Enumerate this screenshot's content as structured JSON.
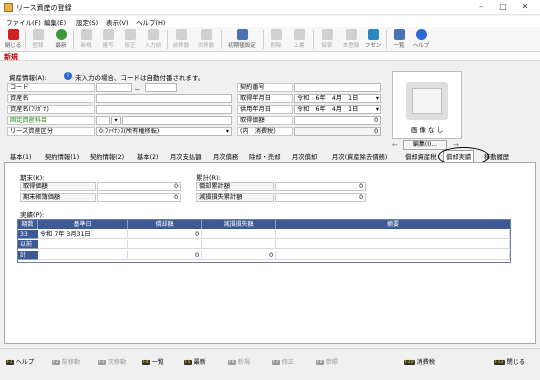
{
  "window": {
    "title": "リース資産の登録"
  },
  "menu": [
    "ファイル(F)",
    "編集(E)",
    "設定(S)",
    "表示(V)",
    "ヘルプ(H)"
  ],
  "toolbar": {
    "items": [
      {
        "label": "閉じる",
        "icon": "close-icon",
        "color": "#d32020"
      },
      {
        "label": "登録",
        "icon": "save-icon",
        "color": "#888888"
      },
      {
        "label": "最新",
        "icon": "refresh-icon",
        "color": "#3a9a3a"
      },
      {
        "label": "新規",
        "icon": "new-icon",
        "color": "#888888"
      },
      {
        "label": "複写",
        "icon": "copy-icon",
        "color": "#888888"
      },
      {
        "label": "修正",
        "icon": "edit-icon",
        "color": "#888888"
      },
      {
        "label": "入力前",
        "icon": "undo-icon",
        "color": "#888888"
      },
      {
        "label": "前移動",
        "icon": "up-icon",
        "color": "#888888"
      },
      {
        "label": "次移動",
        "icon": "down-icon",
        "color": "#888888"
      },
      {
        "label": "初期値設定",
        "icon": "grid-settings-icon",
        "color": "#4a70b8"
      },
      {
        "label": "削除",
        "icon": "delete-icon",
        "color": "#888888"
      },
      {
        "label": "上書",
        "icon": "overwrite-icon",
        "color": "#888888"
      },
      {
        "label": "探索",
        "icon": "search-icon",
        "color": "#888888"
      },
      {
        "label": "本登録",
        "icon": "register-icon",
        "color": "#888888"
      },
      {
        "label": "フセン",
        "icon": "sticky-note-icon",
        "color": "#2a8ac0"
      },
      {
        "label": "一覧",
        "icon": "list-icon",
        "color": "#4a70b8"
      },
      {
        "label": "ヘルプ",
        "icon": "help-icon",
        "color": "#2a6ad0"
      }
    ]
  },
  "mode": "新規",
  "asset_info": {
    "section_label": "資産情報(A):",
    "notice": "未入力の場合、コードは自動付番されます。",
    "code_label": "コード",
    "code_dash": "－",
    "name_label": "資産名",
    "kana_label": "資産名(ﾌﾘｶﾞﾅ)",
    "fixed_subject_label": "固定資産科目",
    "category_label": "リース資産区分",
    "category_value": "0:ﾌｧｲﾅﾝｽ(所有権移転)"
  },
  "contract": {
    "number_label": "契約番号",
    "acquire_label": "取得年月日",
    "acquire_value": "令和　6年　4月　1日",
    "use_label": "供用年月日",
    "use_value": "令和　6年　4月　1日",
    "price_label": "取得価額",
    "price_value": "0",
    "tax_label": "(内　消費税)",
    "tax_value": "0"
  },
  "photo": {
    "caption": "画 像 な し",
    "edit_button": "編集(I)..."
  },
  "tabs": [
    "基本(1)",
    "契約情報(1)",
    "契約情報(2)",
    "基本(2)",
    "月次支払額",
    "月次償務",
    "除却・売却",
    "月次償却",
    "月次(資産除去債務)",
    "償却資産税",
    "償却実績",
    "移動履歴"
  ],
  "active_tab": "償却実績",
  "summary": {
    "period_label": "期末(K):",
    "acq_label": "取得価額",
    "acq_value": "0",
    "book_label": "期末帳簿価額",
    "book_value": "0",
    "cumulative_label": "累計(R):",
    "dep_label": "償却累計額",
    "dep_value": "0",
    "imp_label": "減損損失累計額",
    "imp_value": "0"
  },
  "records": {
    "label": "実績(P):",
    "headers": [
      "期数",
      "基準日",
      "償却額",
      "減損損失額",
      "摘要"
    ],
    "rows": [
      {
        "period": "33",
        "date": "令和 7年 3月31日",
        "dep": "0",
        "imp": "",
        "memo": ""
      },
      {
        "period": "以前",
        "date": "",
        "dep": "",
        "imp": "",
        "memo": ""
      },
      {
        "period": "計",
        "date": "",
        "dep": "0",
        "imp": "0",
        "memo": ""
      }
    ]
  },
  "footer": [
    {
      "key": "F1",
      "label": "ヘルプ",
      "enabled": true
    },
    {
      "key": "F2",
      "label": "前移動",
      "enabled": false
    },
    {
      "key": "F3",
      "label": "次移動",
      "enabled": false
    },
    {
      "key": "F4",
      "label": "一覧",
      "enabled": true
    },
    {
      "key": "F5",
      "label": "最新",
      "enabled": true
    },
    {
      "key": "F6",
      "label": "新規",
      "enabled": false
    },
    {
      "key": "F7",
      "label": "修正",
      "enabled": false
    },
    {
      "key": "F8",
      "label": "参照",
      "enabled": false
    },
    {
      "key": "F10",
      "label": "消費税",
      "enabled": true
    },
    {
      "key": "F12",
      "label": "閉じる",
      "enabled": true
    }
  ]
}
